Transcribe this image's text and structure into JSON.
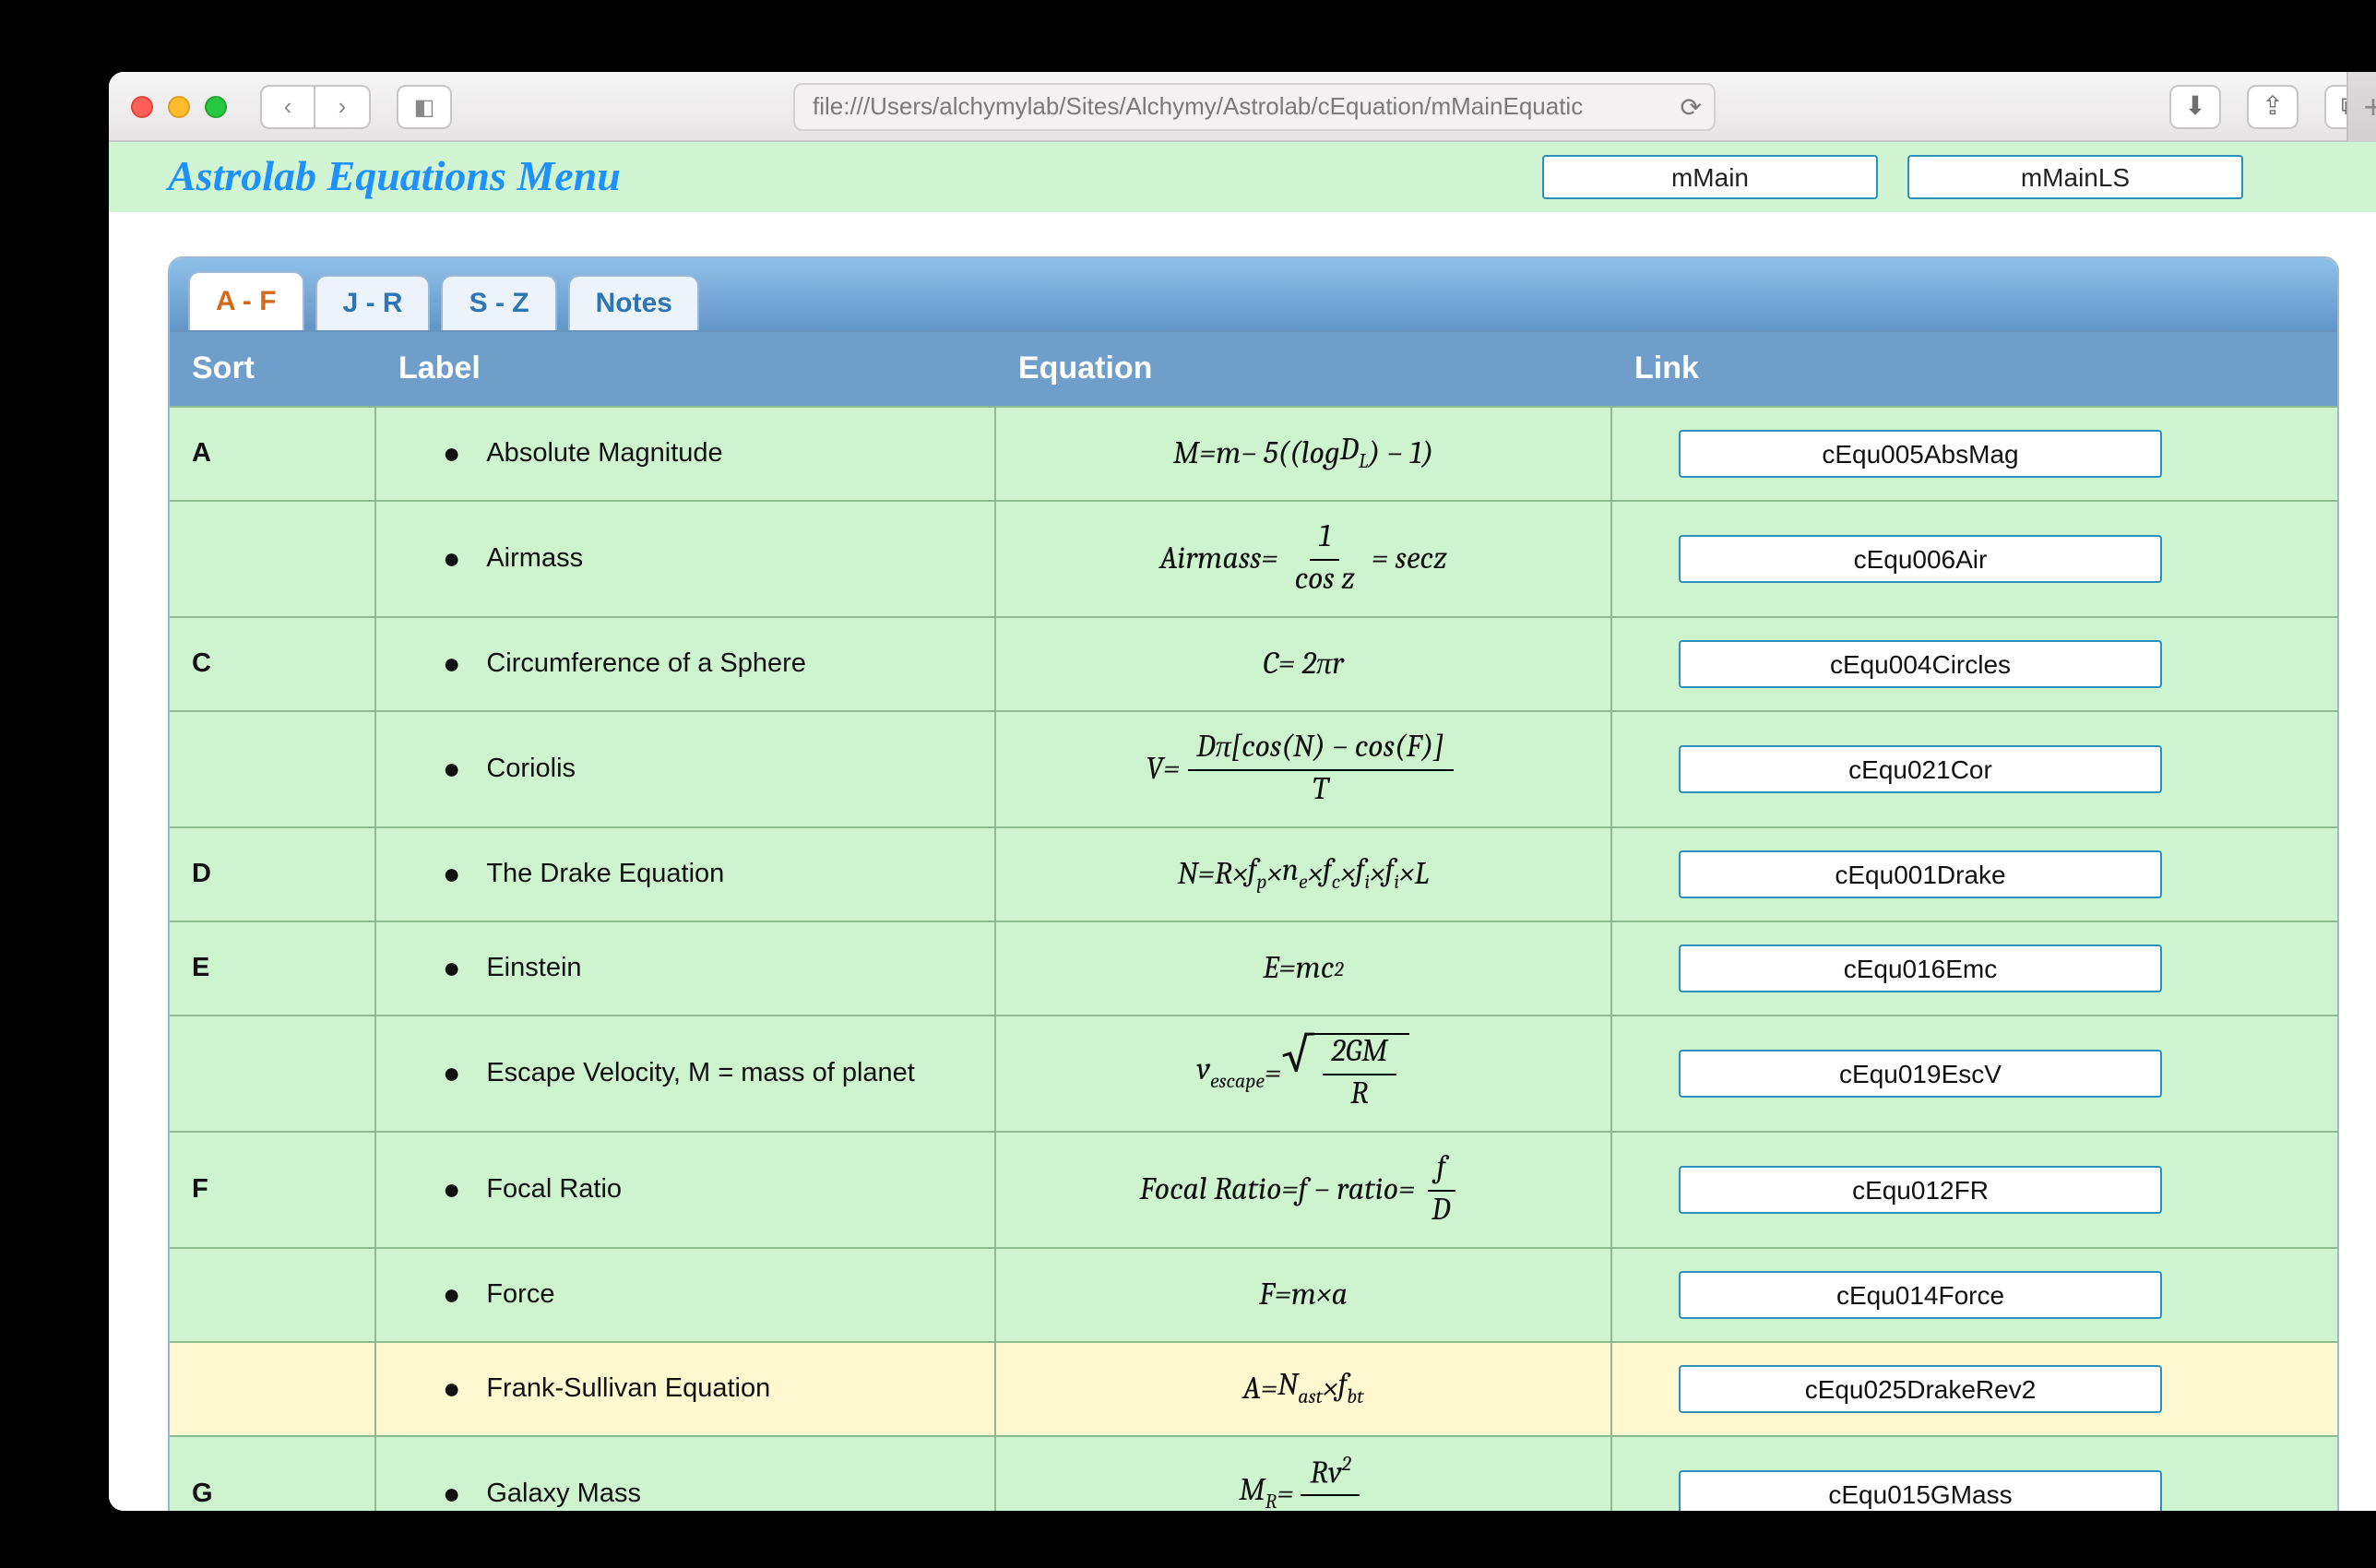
{
  "browser": {
    "url": "file:///Users/alchymylab/Sites/Alchymy/Astrolab/cEquation/mMainEquatic"
  },
  "header": {
    "title": "Astrolab Equations Menu",
    "buttons": [
      "mMain",
      "mMainLS"
    ]
  },
  "tabs": [
    "A - F",
    "J - R",
    "S - Z",
    "Notes"
  ],
  "active_tab": 0,
  "columns": [
    "Sort",
    "Label",
    "Equation",
    "Link"
  ],
  "rows": [
    {
      "sort": "A",
      "label": "Absolute Magnitude",
      "eq_html": "<i>M</i> = <i>m</i> − 5((log <i>D<sub>L</sub></i> ) − 1)",
      "link": "cEqu005AbsMag",
      "tall": false
    },
    {
      "sort": "",
      "label": "Airmass",
      "eq_html": "<i>Airmass</i> = <span class=frac><span class=num>1</span><span class=den>cos <i>z</i></span></span> = sec <i>z</i>",
      "link": "cEqu006Air",
      "tall": true
    },
    {
      "sort": "C",
      "label": "Circumference of a Sphere",
      "eq_html": "<i>C</i> = 2π<i>r</i>",
      "link": "cEqu004Circles",
      "tall": false
    },
    {
      "sort": "",
      "label": "Coriolis",
      "eq_html": "<i>V</i> = <span class=frac><span class=num><i>D</i>π[cos(<i>N</i>) − cos(<i>F</i>)]</span><span class=den><i>T</i></span></span>",
      "link": "cEqu021Cor",
      "tall": true
    },
    {
      "sort": "D",
      "label": "The Drake Equation",
      "eq_html": "<i>N</i> = <i>R</i> × <i>f<sub>p</sub></i> × <i>n<sub>e</sub></i> × <i>f<sub>c</sub></i> × <i>f<sub>i</sub></i> × <i>f<sub>i</sub></i> × <i>L</i>",
      "link": "cEqu001Drake",
      "tall": false
    },
    {
      "sort": "E",
      "label": "Einstein",
      "eq_html": "<i>E</i> = <i>mc</i><sup>2</sup>",
      "link": "cEqu016Emc",
      "tall": false
    },
    {
      "sort": "",
      "label": "Escape Velocity, M = mass of planet",
      "eq_html": "<i>v<sub>escape</sub></i> = <span class=sqrt><span class=rad>√</span><span class=under><span class=frac><span class=num>2<i>GM</i></span><span class=den><i>R</i></span></span></span></span>",
      "link": "cEqu019EscV",
      "tall": true
    },
    {
      "sort": "F",
      "label": "Focal Ratio",
      "eq_html": "<i>Focal Ratio</i> = <i>f − ratio</i> = <span class=frac><span class=num><i>f</i></span><span class=den><i>D</i></span></span>",
      "link": "cEqu012FR",
      "tall": true
    },
    {
      "sort": "",
      "label": "Force",
      "eq_html": "<i>F</i> = <i>m</i> × <i>a</i>",
      "link": "cEqu014Force",
      "tall": false
    },
    {
      "sort": "",
      "label": "Frank-Sullivan Equation",
      "eq_html": "<i>A</i> = <i>N<sub>ast</sub></i> × <i>f<sub>bt</sub></i>",
      "link": "cEqu025DrakeRev2",
      "tall": false,
      "alt": true
    },
    {
      "sort": "G",
      "label": "Galaxy Mass",
      "eq_html": "<i>M<sub>R</sub></i> = <span class=frac><span class=num><i>R</i><i>v</i><sup>2</sup></span><span class=den>&nbsp;</span></span>",
      "link": "cEqu015GMass",
      "tall": true
    }
  ]
}
